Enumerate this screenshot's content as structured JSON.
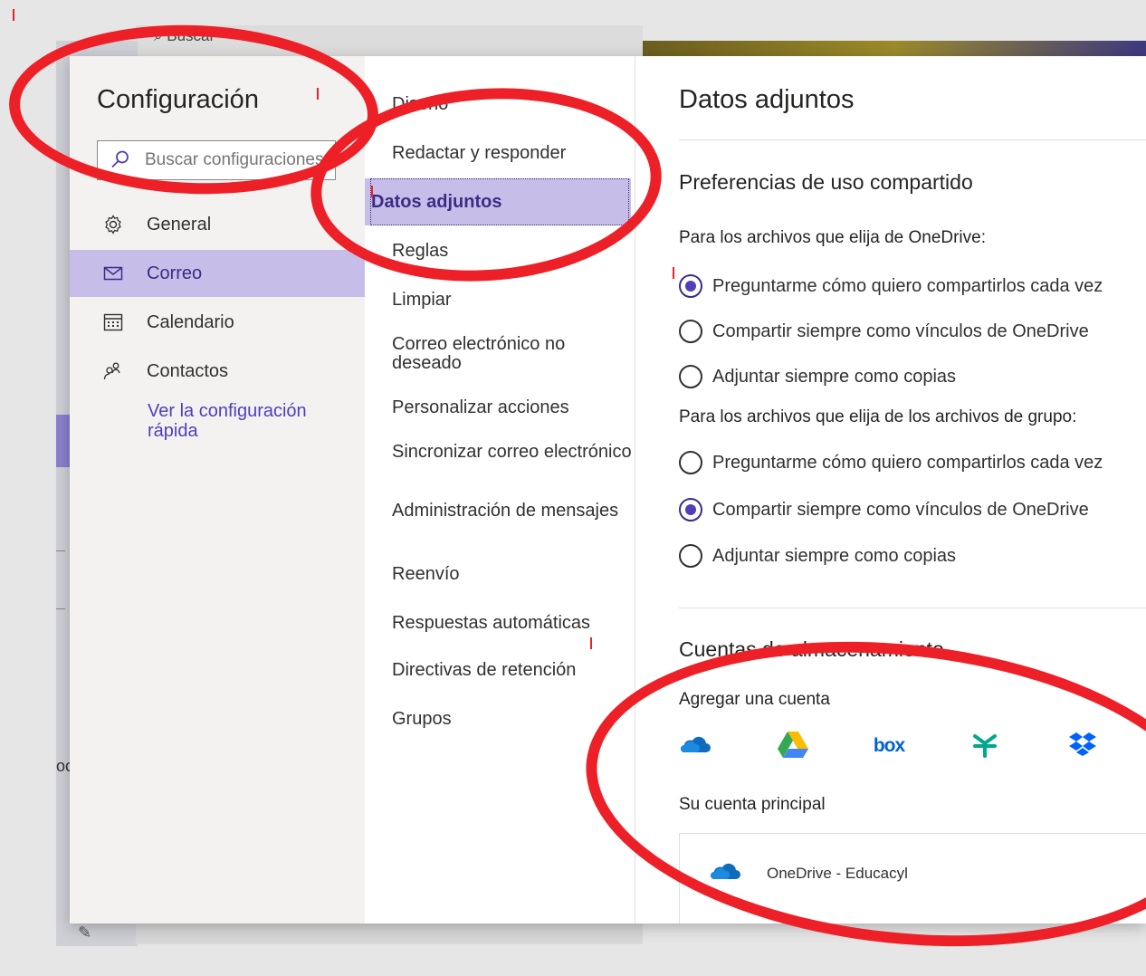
{
  "background_app": {
    "search_label": "Buscar",
    "fragment_text": "oc"
  },
  "dialog": {
    "title": "Configuración",
    "search_placeholder": "Buscar configuraciones",
    "categories": [
      {
        "label": "General",
        "icon": "gear-icon",
        "selected": false
      },
      {
        "label": "Correo",
        "icon": "mail-icon",
        "selected": true
      },
      {
        "label": "Calendario",
        "icon": "calendar-icon",
        "selected": false
      },
      {
        "label": "Contactos",
        "icon": "contacts-icon",
        "selected": false
      }
    ],
    "quick_settings_link": "Ver la configuración rápida"
  },
  "mail_settings_nav": [
    {
      "label": "Diseño",
      "selected": false
    },
    {
      "label": "Redactar y responder",
      "selected": false
    },
    {
      "label": "Datos adjuntos",
      "selected": true
    },
    {
      "label": "Reglas",
      "selected": false
    },
    {
      "label": "Limpiar",
      "selected": false
    },
    {
      "label": "Correo electrónico no deseado",
      "selected": false
    },
    {
      "label": "Personalizar acciones",
      "selected": false
    },
    {
      "label": "Sincronizar correo electrónico",
      "selected": false
    },
    {
      "label": "Administración de mensajes",
      "selected": false
    },
    {
      "label": "Reenvío",
      "selected": false
    },
    {
      "label": "Respuestas automáticas",
      "selected": false
    },
    {
      "label": "Directivas de retención",
      "selected": false
    },
    {
      "label": "Grupos",
      "selected": false
    }
  ],
  "attachments": {
    "title": "Datos adjuntos",
    "sharing_section_title": "Preferencias de uso compartido",
    "onedrive_question": "Para los archivos que elija de OneDrive:",
    "onedrive_options": [
      {
        "label": "Preguntarme cómo quiero compartirlos cada vez",
        "checked": true
      },
      {
        "label": "Compartir siempre como vínculos de OneDrive",
        "checked": false
      },
      {
        "label": "Adjuntar siempre como copias",
        "checked": false
      }
    ],
    "group_question": "Para los archivos que elija de los archivos de grupo:",
    "group_options": [
      {
        "label": "Preguntarme cómo quiero compartirlos cada vez",
        "checked": false
      },
      {
        "label": "Compartir siempre como vínculos de OneDrive",
        "checked": true
      },
      {
        "label": "Adjuntar siempre como copias",
        "checked": false
      }
    ],
    "storage_section_title": "Cuentas de almacenamiento",
    "add_account_label": "Agregar una cuenta",
    "providers": [
      {
        "name": "OneDrive",
        "icon": "onedrive-icon"
      },
      {
        "name": "Google Drive",
        "icon": "google-drive-icon"
      },
      {
        "name": "Box",
        "icon": "box-icon",
        "text": "box"
      },
      {
        "name": "Egnyte",
        "icon": "egnyte-icon"
      },
      {
        "name": "Dropbox",
        "icon": "dropbox-icon"
      }
    ],
    "primary_account_label": "Su cuenta principal",
    "primary_account_name": "OneDrive - Educacyl"
  },
  "colors": {
    "accent": "#4f3fbb",
    "selected_bg": "#c7bde9",
    "annotation_red": "#ee2027"
  }
}
